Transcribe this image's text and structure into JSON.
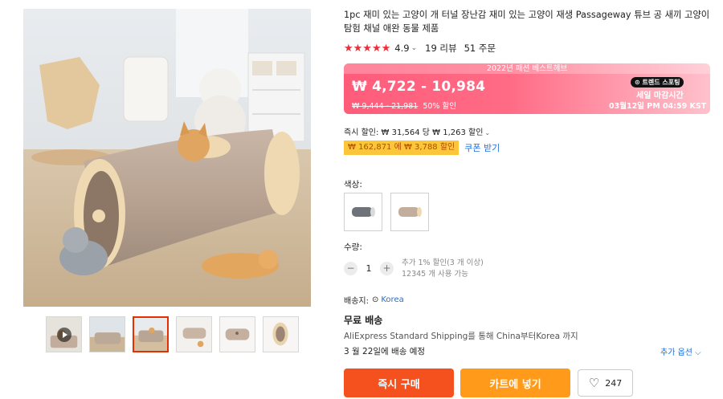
{
  "product": {
    "title": "1pc 재미 있는 고양이 개 터널 장난감 재미 있는 고양이 재생 Passageway 튜브 공 새끼 고양이 탐험 채널 애완 동물 제품",
    "stars": "★★★★★",
    "rating": "4.9",
    "rating_chevron": "⌄",
    "reviews": "19 리뷰",
    "orders": "51 주문"
  },
  "price": {
    "banner": "2022년 패션 베스트헤브",
    "range": "₩ 4,722 - 10,984",
    "original": "₩ 9,444 - 21,981",
    "discount": "50% 할인",
    "trend_badge": "⊙ 트렌드 스포팅",
    "sale_label": "세일 마감시간",
    "sale_end": "03월12일 PM 04:59 KST"
  },
  "discounts": {
    "instant": "즉시 할인: ₩ 31,564 당 ₩ 1,263 할인",
    "instant_chevron": "⌄",
    "coupon": "₩ 162,871 에 ₩ 3,788 할인",
    "coupon_link": "쿠폰 받기"
  },
  "color": {
    "label": "색상:",
    "options": [
      "gray-tunnel",
      "beige-tunnel"
    ]
  },
  "quantity": {
    "label": "수량:",
    "minus": "−",
    "value": "1",
    "plus": "+",
    "bulk_note": "추가 1% 할인(3 개 이상)",
    "available": "12345 개 사용 가능"
  },
  "shipping": {
    "ship_to_label": "배송지:",
    "pin_icon": "⊙",
    "location": "Korea",
    "free": "무료 배송",
    "method": "AliExpress Standard Shipping를 통해 China부터Korea 까지",
    "eta": "3 월 22일에 배송 예정",
    "more_options": "추가 옵션 ⌵"
  },
  "actions": {
    "buy_now": "즉시 구매",
    "add_to_cart": "카트에 넣기",
    "wishlist_icon": "♡",
    "wishlist_count": "247"
  },
  "colors": {
    "accent_red": "#f4511e",
    "cart_orange": "#ff9a1b",
    "star_red": "#f02c36",
    "link_blue": "#1e6fd9",
    "coupon_yellow": "#fcc63b"
  }
}
